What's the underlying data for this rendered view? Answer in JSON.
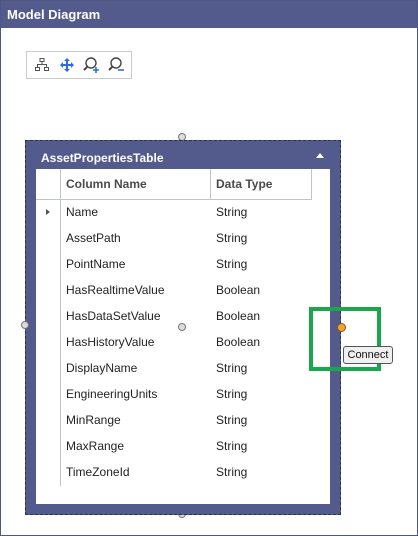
{
  "window": {
    "title": "Model Diagram"
  },
  "toolbar": {
    "tools": [
      {
        "icon": "hierarchy-layout-icon"
      },
      {
        "icon": "move-arrows-icon"
      },
      {
        "icon": "zoom-in-icon"
      },
      {
        "icon": "zoom-out-icon"
      }
    ]
  },
  "table_node": {
    "title": "AssetPropertiesTable",
    "columns": [
      "Column Name",
      "Data Type"
    ],
    "rows": [
      {
        "name": "Name",
        "type": "String"
      },
      {
        "name": "AssetPath",
        "type": "String"
      },
      {
        "name": "PointName",
        "type": "String"
      },
      {
        "name": "HasRealtimeValue",
        "type": "Boolean"
      },
      {
        "name": "HasDataSetValue",
        "type": "Boolean"
      },
      {
        "name": "HasHistoryValue",
        "type": "Boolean"
      },
      {
        "name": "DisplayName",
        "type": "String"
      },
      {
        "name": "EngineeringUnits",
        "type": "String"
      },
      {
        "name": "MinRange",
        "type": "String"
      },
      {
        "name": "MaxRange",
        "type": "String"
      },
      {
        "name": "TimeZoneId",
        "type": "String"
      }
    ]
  },
  "connect": {
    "label": "Connect"
  },
  "colors": {
    "titlebar": "#525b8c",
    "highlight": "#1aa64a",
    "port": "#f0a330"
  }
}
